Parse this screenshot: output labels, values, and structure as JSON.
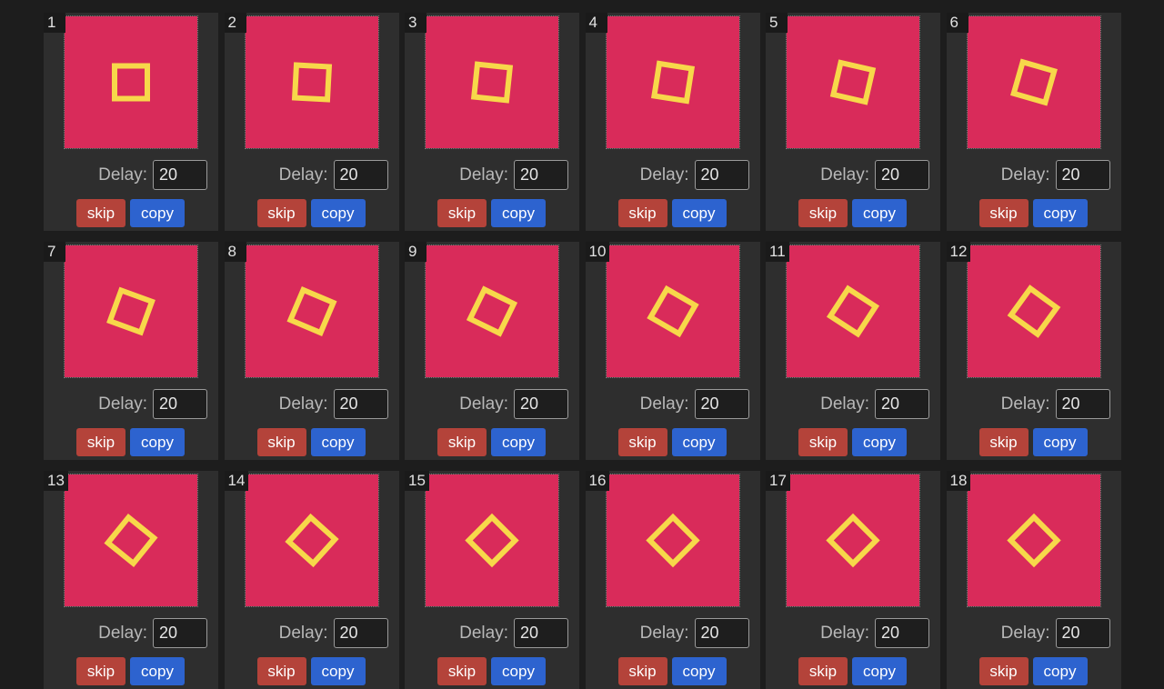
{
  "colors": {
    "background": "#1d1d1d",
    "card": "#2e2e2e",
    "frame_fill": "#d92b5a",
    "square_stroke": "#f7d84a",
    "skip_button": "#b4433a",
    "copy_button": "#2d63cf"
  },
  "labels": {
    "delay": "Delay:",
    "skip": "skip",
    "copy": "copy"
  },
  "frames": [
    {
      "number": "1",
      "delay": "20",
      "rotation_deg": 0
    },
    {
      "number": "2",
      "delay": "20",
      "rotation_deg": 3
    },
    {
      "number": "3",
      "delay": "20",
      "rotation_deg": 6
    },
    {
      "number": "4",
      "delay": "20",
      "rotation_deg": 9
    },
    {
      "number": "5",
      "delay": "20",
      "rotation_deg": 13
    },
    {
      "number": "6",
      "delay": "20",
      "rotation_deg": 16
    },
    {
      "number": "7",
      "delay": "20",
      "rotation_deg": 20
    },
    {
      "number": "8",
      "delay": "20",
      "rotation_deg": 23
    },
    {
      "number": "9",
      "delay": "20",
      "rotation_deg": 26
    },
    {
      "number": "10",
      "delay": "20",
      "rotation_deg": 30
    },
    {
      "number": "11",
      "delay": "20",
      "rotation_deg": 33
    },
    {
      "number": "12",
      "delay": "20",
      "rotation_deg": 36
    },
    {
      "number": "13",
      "delay": "20",
      "rotation_deg": 39
    },
    {
      "number": "14",
      "delay": "20",
      "rotation_deg": 42
    },
    {
      "number": "15",
      "delay": "20",
      "rotation_deg": 45
    },
    {
      "number": "16",
      "delay": "20",
      "rotation_deg": 45
    },
    {
      "number": "17",
      "delay": "20",
      "rotation_deg": 45
    },
    {
      "number": "18",
      "delay": "20",
      "rotation_deg": 45
    }
  ]
}
